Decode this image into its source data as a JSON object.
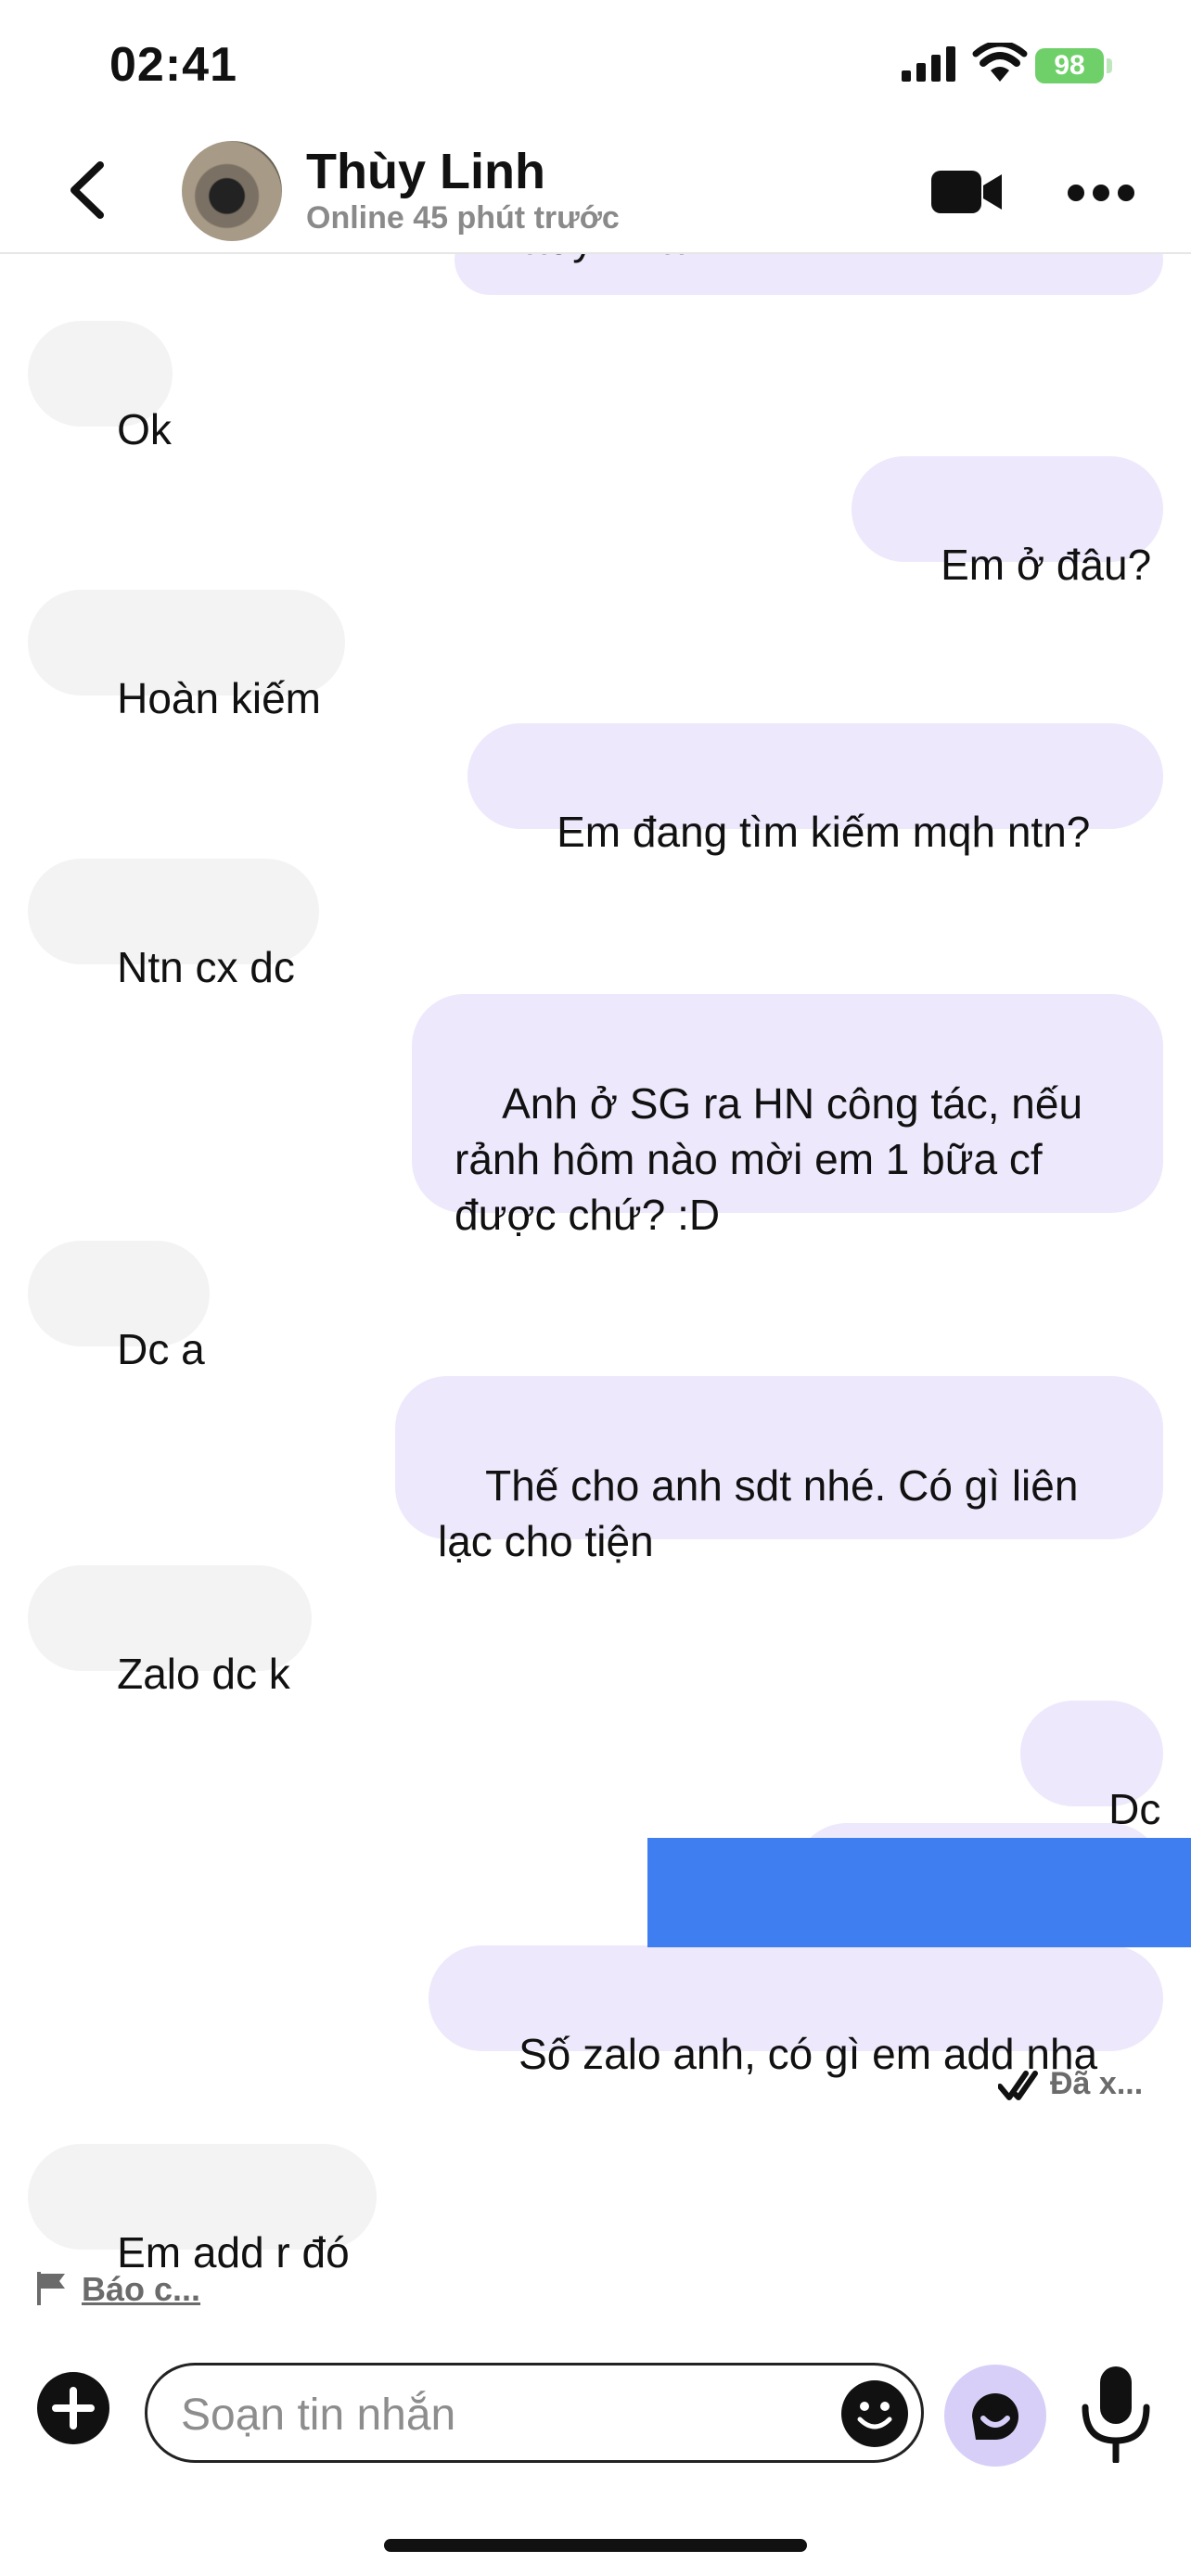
{
  "status_bar": {
    "time": "02:41",
    "battery": "98"
  },
  "header": {
    "name": "Thùy Linh",
    "status": "Online 45 phút trước"
  },
  "messages": [
    {
      "side": "out",
      "text": "Thùy Linh."
    },
    {
      "side": "in",
      "text": "Ok"
    },
    {
      "side": "out",
      "text": "Em ở đâu?"
    },
    {
      "side": "in",
      "text": "Hoàn kiếm"
    },
    {
      "side": "out",
      "text": "Em đang tìm kiếm mqh ntn?"
    },
    {
      "side": "in",
      "text": "Ntn cx dc"
    },
    {
      "side": "out",
      "text": "Anh ở SG ra HN công tác, nếu rảnh hôm nào mời em 1 bữa cf được chứ? :D"
    },
    {
      "side": "in",
      "text": "Dc a"
    },
    {
      "side": "out",
      "text": "Thế cho anh sdt nhé. Có gì liên lạc cho tiện"
    },
    {
      "side": "in",
      "text": "Zalo dc k"
    },
    {
      "side": "out",
      "text": "Dc"
    },
    {
      "side": "out",
      "text": "Số zalo anh, có gì em add nha"
    },
    {
      "side": "in",
      "text": "Em add r đó"
    }
  ],
  "read_receipt": "Đã x...",
  "report_link": "Báo c...",
  "composer": {
    "placeholder": "Soạn tin nhắn"
  },
  "colors": {
    "incoming_bubble": "#f3f3f3",
    "outgoing_bubble": "#ede8fb",
    "redaction": "#3f7ef0",
    "battery": "#6fd06a"
  },
  "icons": [
    "back-chevron-icon",
    "video-camera-icon",
    "more-dots-icon",
    "plus-icon",
    "emoji-icon",
    "ai-assistant-icon",
    "microphone-icon",
    "double-check-icon",
    "flag-icon"
  ]
}
